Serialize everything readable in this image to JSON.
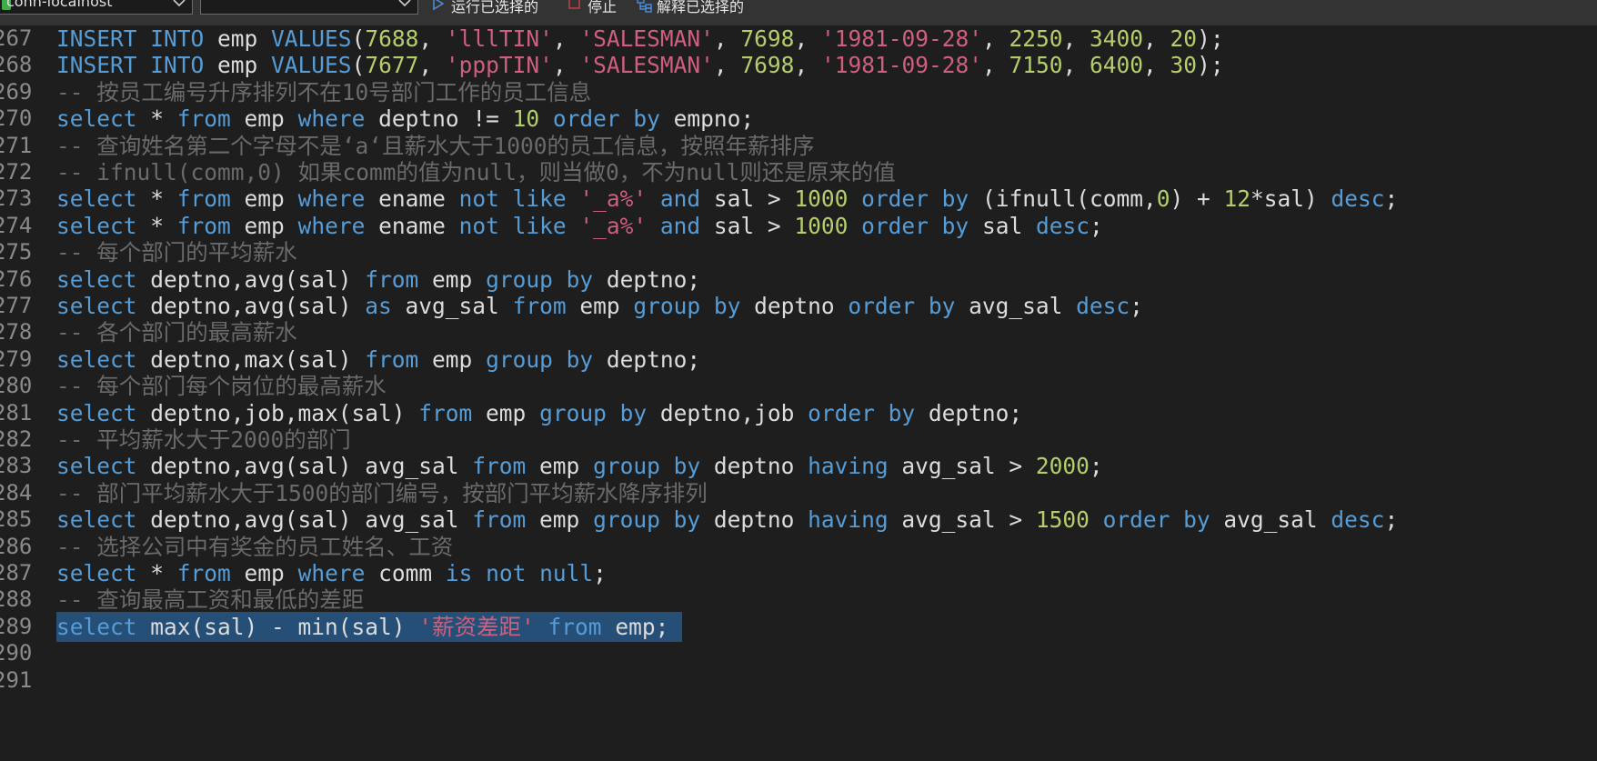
{
  "toolbar": {
    "connection": "conn-localhost",
    "database": "",
    "run_selected": "运行已选择的",
    "stop": "停止",
    "explain_selected": "解释已选择的"
  },
  "editor": {
    "lines": [
      {
        "n": "267",
        "tokens": [
          [
            "kw",
            "INSERT "
          ],
          [
            "kw",
            "INTO "
          ],
          [
            "id",
            "emp "
          ],
          [
            "kw",
            "VALUES"
          ],
          [
            "id",
            "("
          ],
          [
            "num",
            "7688"
          ],
          [
            "id",
            ", "
          ],
          [
            "str",
            "'lllTIN'"
          ],
          [
            "id",
            ", "
          ],
          [
            "str",
            "'SALESMAN'"
          ],
          [
            "id",
            ", "
          ],
          [
            "num",
            "7698"
          ],
          [
            "id",
            ", "
          ],
          [
            "str",
            "'1981-09-28'"
          ],
          [
            "id",
            ", "
          ],
          [
            "num",
            "2250"
          ],
          [
            "id",
            ", "
          ],
          [
            "num",
            "3400"
          ],
          [
            "id",
            ", "
          ],
          [
            "num",
            "20"
          ],
          [
            "id",
            ");"
          ]
        ]
      },
      {
        "n": "268",
        "tokens": [
          [
            "kw",
            "INSERT "
          ],
          [
            "kw",
            "INTO "
          ],
          [
            "id",
            "emp "
          ],
          [
            "kw",
            "VALUES"
          ],
          [
            "id",
            "("
          ],
          [
            "num",
            "7677"
          ],
          [
            "id",
            ", "
          ],
          [
            "str",
            "'pppTIN'"
          ],
          [
            "id",
            ", "
          ],
          [
            "str",
            "'SALESMAN'"
          ],
          [
            "id",
            ", "
          ],
          [
            "num",
            "7698"
          ],
          [
            "id",
            ", "
          ],
          [
            "str",
            "'1981-09-28'"
          ],
          [
            "id",
            ", "
          ],
          [
            "num",
            "7150"
          ],
          [
            "id",
            ", "
          ],
          [
            "num",
            "6400"
          ],
          [
            "id",
            ", "
          ],
          [
            "num",
            "30"
          ],
          [
            "id",
            ");"
          ]
        ]
      },
      {
        "n": "269",
        "tokens": [
          [
            "cm",
            "-- 按员工编号升序排列不在10号部门工作的员工信息"
          ]
        ]
      },
      {
        "n": "270",
        "tokens": [
          [
            "kw",
            "select "
          ],
          [
            "id",
            "* "
          ],
          [
            "kw",
            "from "
          ],
          [
            "id",
            "emp "
          ],
          [
            "kw",
            "where "
          ],
          [
            "id",
            "deptno != "
          ],
          [
            "num",
            "10 "
          ],
          [
            "kw",
            "order by "
          ],
          [
            "id",
            "empno;"
          ]
        ]
      },
      {
        "n": "271",
        "tokens": [
          [
            "cm",
            "-- 查询姓名第二个字母不是‘a‘且薪水大于1000的员工信息，按照年薪排序"
          ]
        ]
      },
      {
        "n": "272",
        "tokens": [
          [
            "cm",
            "-- ifnull(comm,0) 如果comm的值为null，则当做0，不为null则还是原来的值"
          ]
        ]
      },
      {
        "n": "273",
        "tokens": [
          [
            "kw",
            "select "
          ],
          [
            "id",
            "* "
          ],
          [
            "kw",
            "from "
          ],
          [
            "id",
            "emp "
          ],
          [
            "kw",
            "where "
          ],
          [
            "id",
            "ename "
          ],
          [
            "kw",
            "not like "
          ],
          [
            "str",
            "'_a%' "
          ],
          [
            "kw",
            "and "
          ],
          [
            "id",
            "sal > "
          ],
          [
            "num",
            "1000 "
          ],
          [
            "kw",
            "order by "
          ],
          [
            "id",
            "(ifnull(comm,"
          ],
          [
            "num",
            "0"
          ],
          [
            "id",
            ") + "
          ],
          [
            "num",
            "12"
          ],
          [
            "id",
            "*sal) "
          ],
          [
            "kw",
            "desc"
          ],
          [
            "id",
            ";"
          ]
        ]
      },
      {
        "n": "274",
        "tokens": [
          [
            "kw",
            "select "
          ],
          [
            "id",
            "* "
          ],
          [
            "kw",
            "from "
          ],
          [
            "id",
            "emp "
          ],
          [
            "kw",
            "where "
          ],
          [
            "id",
            "ename "
          ],
          [
            "kw",
            "not like "
          ],
          [
            "str",
            "'_a%' "
          ],
          [
            "kw",
            "and "
          ],
          [
            "id",
            "sal > "
          ],
          [
            "num",
            "1000 "
          ],
          [
            "kw",
            "order by "
          ],
          [
            "id",
            "sal "
          ],
          [
            "kw",
            "desc"
          ],
          [
            "id",
            ";"
          ]
        ]
      },
      {
        "n": "275",
        "tokens": [
          [
            "cm",
            "-- 每个部门的平均薪水"
          ]
        ]
      },
      {
        "n": "276",
        "tokens": [
          [
            "kw",
            "select "
          ],
          [
            "id",
            "deptno,avg(sal) "
          ],
          [
            "kw",
            "from "
          ],
          [
            "id",
            "emp "
          ],
          [
            "kw",
            "group by "
          ],
          [
            "id",
            "deptno;"
          ]
        ]
      },
      {
        "n": "277",
        "tokens": [
          [
            "kw",
            "select "
          ],
          [
            "id",
            "deptno,avg(sal) "
          ],
          [
            "kw",
            "as "
          ],
          [
            "id",
            "avg_sal "
          ],
          [
            "kw",
            "from "
          ],
          [
            "id",
            "emp "
          ],
          [
            "kw",
            "group by "
          ],
          [
            "id",
            "deptno "
          ],
          [
            "kw",
            "order by "
          ],
          [
            "id",
            "avg_sal "
          ],
          [
            "kw",
            "desc"
          ],
          [
            "id",
            ";"
          ]
        ]
      },
      {
        "n": "278",
        "tokens": [
          [
            "cm",
            "-- 各个部门的最高薪水"
          ]
        ]
      },
      {
        "n": "279",
        "tokens": [
          [
            "kw",
            "select "
          ],
          [
            "id",
            "deptno,max(sal) "
          ],
          [
            "kw",
            "from "
          ],
          [
            "id",
            "emp "
          ],
          [
            "kw",
            "group by "
          ],
          [
            "id",
            "deptno;"
          ]
        ]
      },
      {
        "n": "280",
        "tokens": [
          [
            "cm",
            "-- 每个部门每个岗位的最高薪水"
          ]
        ]
      },
      {
        "n": "281",
        "tokens": [
          [
            "kw",
            "select "
          ],
          [
            "id",
            "deptno,job,max(sal) "
          ],
          [
            "kw",
            "from "
          ],
          [
            "id",
            "emp "
          ],
          [
            "kw",
            "group by "
          ],
          [
            "id",
            "deptno,job "
          ],
          [
            "kw",
            "order by "
          ],
          [
            "id",
            "deptno;"
          ]
        ]
      },
      {
        "n": "282",
        "tokens": [
          [
            "cm",
            "-- 平均薪水大于2000的部门"
          ]
        ]
      },
      {
        "n": "283",
        "tokens": [
          [
            "kw",
            "select "
          ],
          [
            "id",
            "deptno,avg(sal) avg_sal "
          ],
          [
            "kw",
            "from "
          ],
          [
            "id",
            "emp "
          ],
          [
            "kw",
            "group by "
          ],
          [
            "id",
            "deptno "
          ],
          [
            "kw",
            "having "
          ],
          [
            "id",
            "avg_sal > "
          ],
          [
            "num",
            "2000"
          ],
          [
            "id",
            ";"
          ]
        ]
      },
      {
        "n": "284",
        "tokens": [
          [
            "cm",
            "-- 部门平均薪水大于1500的部门编号，按部门平均薪水降序排列"
          ]
        ]
      },
      {
        "n": "285",
        "tokens": [
          [
            "kw",
            "select "
          ],
          [
            "id",
            "deptno,avg(sal) avg_sal "
          ],
          [
            "kw",
            "from "
          ],
          [
            "id",
            "emp "
          ],
          [
            "kw",
            "group by "
          ],
          [
            "id",
            "deptno "
          ],
          [
            "kw",
            "having "
          ],
          [
            "id",
            "avg_sal > "
          ],
          [
            "num",
            "1500 "
          ],
          [
            "kw",
            "order by "
          ],
          [
            "id",
            "avg_sal "
          ],
          [
            "kw",
            "desc"
          ],
          [
            "id",
            ";"
          ]
        ]
      },
      {
        "n": "286",
        "tokens": [
          [
            "cm",
            "-- 选择公司中有奖金的员工姓名、工资"
          ]
        ]
      },
      {
        "n": "287",
        "tokens": [
          [
            "kw",
            "select "
          ],
          [
            "id",
            "* "
          ],
          [
            "kw",
            "from "
          ],
          [
            "id",
            "emp "
          ],
          [
            "kw",
            "where "
          ],
          [
            "id",
            "comm "
          ],
          [
            "kw",
            "is not null"
          ],
          [
            "id",
            ";"
          ]
        ]
      },
      {
        "n": "288",
        "tokens": [
          [
            "cm",
            "-- 查询最高工资和最低的差距"
          ]
        ]
      },
      {
        "n": "289",
        "highlight": true,
        "tokens": [
          [
            "kw",
            "select "
          ],
          [
            "id",
            "max(sal) - min(sal) "
          ],
          [
            "str",
            "'薪资差距' "
          ],
          [
            "kw",
            "from "
          ],
          [
            "id",
            "emp; "
          ]
        ]
      },
      {
        "n": "290",
        "tokens": []
      },
      {
        "n": "291",
        "tokens": []
      }
    ]
  }
}
